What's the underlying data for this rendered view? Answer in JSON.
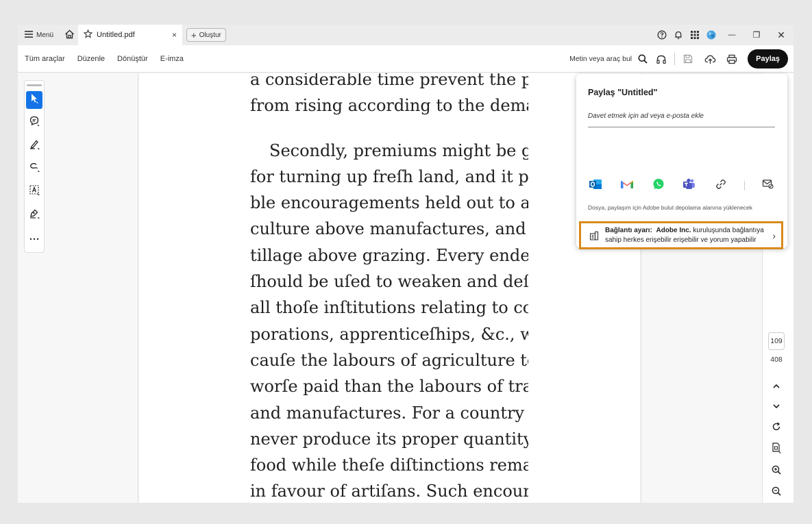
{
  "titlebar": {
    "menu_label": "Menü",
    "tab_title": "Untitled.pdf",
    "tab_close": "×",
    "new_tab_label": "Oluştur",
    "new_tab_plus": "+",
    "minimize": "—",
    "restore": "❐",
    "close": "✕"
  },
  "toolbar": {
    "links": [
      "Tüm araçlar",
      "Düzenle",
      "Dönüştür",
      "E-imza"
    ],
    "search_label": "Metin veya araç bul",
    "share_label": "Paylaş"
  },
  "document": {
    "paragraph1": "a considerable time prevent the price from rising according to the demand.",
    "paragraph2": "Secondly, premiums might be given for turning up freſh land, and it poſsible encouragements held out to agriculture above manufactures, and to tillage above grazing. Every endeavour ſhould be uſed to weaken and deſtroy all thoſe inſtitutions relating to corporations, apprenticeſhips, &c., which cauſe the labours of agriculture to be worſe paid than the labours of trade and manufactures. For a country can never produce its proper quantity of food while theſe diſtinctions remain in favour of artiſans. Such encourage-",
    "lines1": [
      "a considerable time prevent the price",
      "from rising according to the demand."
    ],
    "lines2": [
      "Secondly, premiums might be given",
      "for turning up freſh land, and it poſsi-",
      "ble encouragements held out to agri-",
      "culture above manufactures, and to",
      "tillage above grazing. Every endeavour",
      "ſhould be uſed to weaken and deſtroy",
      "all thoſe inſtitutions relating to cor-",
      "porations, apprenticeſhips, &c., which",
      "cauſe the labours of agriculture to be",
      "worſe paid than the labours of trade",
      "and manufactures. For a country can",
      "never produce its proper quantity of",
      "food while theſe diſtinctions remain",
      "in favour of artiſans. Such encourage-"
    ]
  },
  "page_nav": {
    "current_page": "109",
    "total_pages": "408",
    "up": "˄",
    "down": "˅"
  },
  "share_panel": {
    "title": "Paylaş \"Untitled\"",
    "invite_placeholder": "Davet etmek için ad veya e-posta ekle",
    "upload_note": "Dosya, paylaşım için Adobe bulut depolama alanına yüklenecek",
    "link_setting_bold": "Bağlantı ayarı:",
    "link_setting_org": "Adobe Inc.",
    "link_setting_rest1": " kuruluşunda bağlantıya",
    "link_setting_rest2": "sahip herkes erişebilir erişebilir ve yorum yapabilir",
    "chevron": "›"
  },
  "colors": {
    "accent_blue": "#1473e6",
    "highlight_orange": "#d98a1a",
    "share_button": "#111111"
  },
  "icons": [
    "hamburger-icon",
    "home-icon",
    "star-icon",
    "help-icon",
    "bell-icon",
    "apps-grid-icon",
    "profile-icon",
    "search-icon",
    "headphones-icon",
    "save-icon",
    "cloud-upload-icon",
    "print-icon",
    "select-cursor-icon",
    "comment-icon",
    "highlight-pen-icon",
    "draw-icon",
    "text-select-icon",
    "fill-sign-icon",
    "more-icon",
    "outlook-icon",
    "gmail-icon",
    "whatsapp-icon",
    "teams-icon",
    "link-icon",
    "email-share-icon",
    "building-icon",
    "rotate-icon",
    "page-fit-icon",
    "zoom-in-icon",
    "zoom-out-icon"
  ]
}
